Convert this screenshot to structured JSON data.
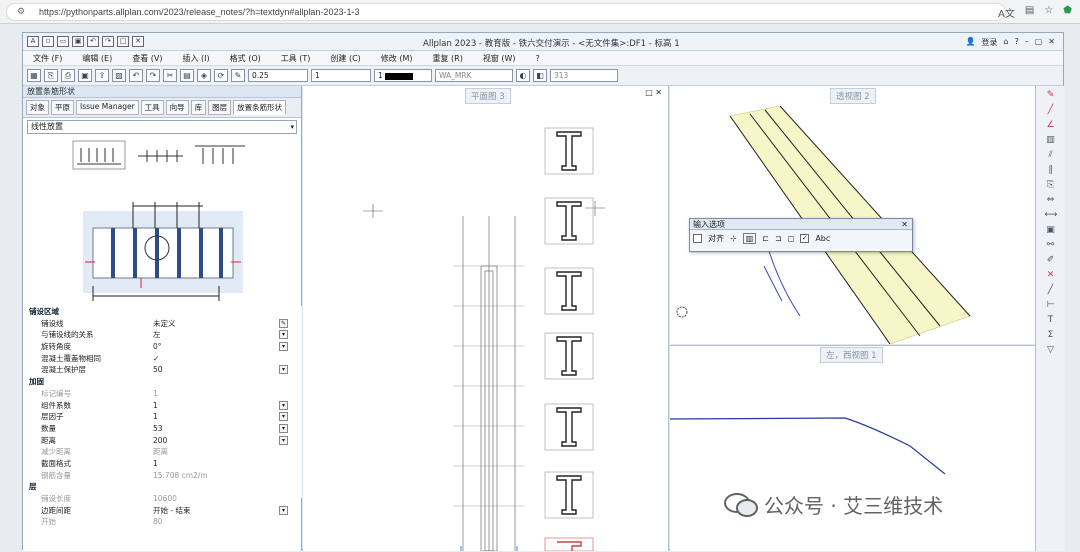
{
  "browser": {
    "url": "https://pythonparts.allplan.com/2023/release_notes/?h=textdyn#allplan-2023-1-3",
    "icons": [
      "translate-icon",
      "reader-icon",
      "star-icon",
      "shield-icon"
    ]
  },
  "app": {
    "title": "Allplan 2023 - 教育版 - 铁六交付演示 - <无文件集>:DF1 - 标高 1",
    "login": "登录",
    "menu": [
      "文件 (F)",
      "编辑 (E)",
      "查看 (V)",
      "插入 (I)",
      "格式 (O)",
      "工具 (T)",
      "创建 (C)",
      "修改 (M)",
      "重复 (R)",
      "视窗 (W)",
      "?"
    ],
    "toolbar": {
      "pen": "0.25",
      "line": "1",
      "color": "1",
      "layer": "WA_MRK",
      "scale": "313"
    }
  },
  "leftpanel": {
    "title": "放置条筋形状",
    "tabs": [
      "对象",
      "平原",
      "Issue Manager",
      "工具",
      "向导",
      "库",
      "图层",
      "放置条筋形状"
    ],
    "active_tab": "放置条筋形状",
    "mode": "线性放置",
    "props": [
      {
        "k": "铺设区域",
        "v": "",
        "type": "hdr"
      },
      {
        "k": "铺设线",
        "v": "未定义",
        "type": "pick"
      },
      {
        "k": "与铺设线的关系",
        "v": "左",
        "type": "dd"
      },
      {
        "k": "旋转角度",
        "v": "0°",
        "type": "dd"
      },
      {
        "k": "混凝土覆盖物相同",
        "v": "✓",
        "type": ""
      },
      {
        "k": "混凝土保护层",
        "v": "50",
        "type": "dd"
      },
      {
        "k": "加固",
        "v": "",
        "type": "hdr"
      },
      {
        "k": "标记编号",
        "v": "1",
        "type": "gray"
      },
      {
        "k": "组件系数",
        "v": "1",
        "type": "dd"
      },
      {
        "k": "层因子",
        "v": "1",
        "type": "dd"
      },
      {
        "k": "数量",
        "v": "53",
        "type": "dd"
      },
      {
        "k": "距离",
        "v": "200",
        "type": "dd"
      },
      {
        "k": "减少距离",
        "v": "距离",
        "type": "gray"
      },
      {
        "k": "截面格式",
        "v": "1",
        "type": ""
      },
      {
        "k": "钢筋含量",
        "v": "15.708 cm2/m",
        "type": "gray"
      },
      {
        "k": "层",
        "v": "",
        "type": "hdr"
      },
      {
        "k": "铺设长度",
        "v": "10600",
        "type": "gray"
      },
      {
        "k": "边距间距",
        "v": "开始 - 结束",
        "type": "dd"
      },
      {
        "k": "开始",
        "v": "80",
        "type": "gray"
      }
    ]
  },
  "views": {
    "a": "平面图 3",
    "b": "透视图 2",
    "c": "左，西视图 1"
  },
  "input_options": {
    "title": "输入选项",
    "align": "对齐",
    "abc": "Abc"
  },
  "watermark": {
    "text": "公众号 · 艾三维技术"
  }
}
